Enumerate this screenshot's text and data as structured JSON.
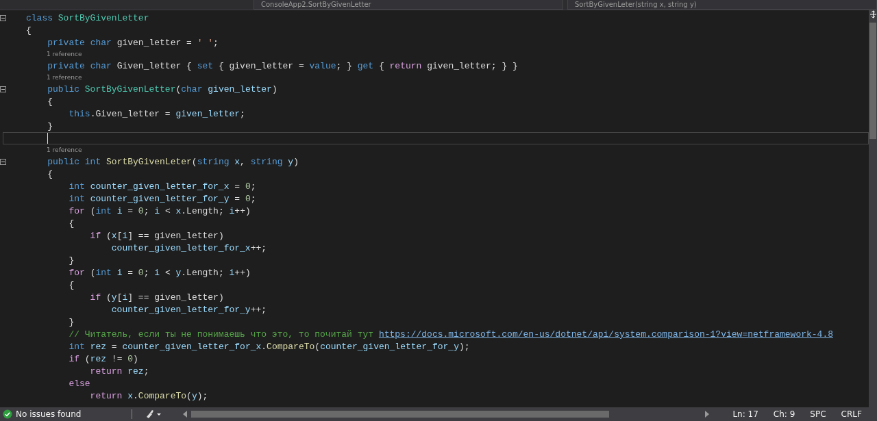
{
  "nav_bar": {
    "items": [
      "ConsoleApp2.SortByGivenLetter",
      "SortByGivenLeter(string x, string y)"
    ]
  },
  "code_lines": [
    {
      "kind": "code",
      "expanded": true,
      "current": false,
      "tokens": [
        {
          "t": "class",
          "kind": "kw"
        },
        {
          "t": " SortByGivenLetter",
          "kind": "type"
        }
      ]
    },
    {
      "kind": "code",
      "current": false,
      "tokens": [
        {
          "t": "{",
          "kind": "plain"
        }
      ]
    },
    {
      "kind": "code",
      "current": false,
      "tokens": [
        {
          "t": "    private",
          "kind": "kw"
        },
        {
          "t": " char",
          "kind": "kw"
        },
        {
          "t": " given_letter = ",
          "kind": "plain"
        },
        {
          "t": "' '",
          "kind": "str"
        },
        {
          "t": ";",
          "kind": "plain"
        }
      ]
    },
    {
      "kind": "reference",
      "text": "1 reference"
    },
    {
      "kind": "code",
      "current": false,
      "tokens": [
        {
          "t": "    private",
          "kind": "kw"
        },
        {
          "t": " char",
          "kind": "kw"
        },
        {
          "t": " Given_letter { ",
          "kind": "plain"
        },
        {
          "t": "set",
          "kind": "kw"
        },
        {
          "t": " { given_letter = ",
          "kind": "plain"
        },
        {
          "t": "value",
          "kind": "kw"
        },
        {
          "t": "; } ",
          "kind": "plain"
        },
        {
          "t": "get",
          "kind": "kw"
        },
        {
          "t": " { ",
          "kind": "plain"
        },
        {
          "t": "return",
          "kind": "ctrl"
        },
        {
          "t": " given_letter; } }",
          "kind": "plain"
        }
      ]
    },
    {
      "kind": "reference",
      "text": "1 reference"
    },
    {
      "kind": "code",
      "expanded": true,
      "current": false,
      "tokens": [
        {
          "t": "    public",
          "kind": "kw"
        },
        {
          "t": " SortByGivenLetter",
          "kind": "type"
        },
        {
          "t": "(",
          "kind": "plain"
        },
        {
          "t": "char",
          "kind": "kw"
        },
        {
          "t": " given_letter",
          "kind": "param"
        },
        {
          "t": ")",
          "kind": "plain"
        }
      ]
    },
    {
      "kind": "code",
      "current": false,
      "tokens": [
        {
          "t": "    {",
          "kind": "plain"
        }
      ]
    },
    {
      "kind": "code",
      "current": false,
      "tokens": [
        {
          "t": "        this",
          "kind": "kw"
        },
        {
          "t": ".Given_letter = ",
          "kind": "plain"
        },
        {
          "t": "given_letter",
          "kind": "param"
        },
        {
          "t": ";",
          "kind": "plain"
        }
      ]
    },
    {
      "kind": "code",
      "current": false,
      "tokens": [
        {
          "t": "    }",
          "kind": "plain"
        }
      ]
    },
    {
      "kind": "code",
      "current": true
    },
    {
      "kind": "reference",
      "text": "1 reference"
    },
    {
      "kind": "code",
      "expanded": true,
      "current": false,
      "tokens": [
        {
          "t": "    public",
          "kind": "kw"
        },
        {
          "t": " int",
          "kind": "kw"
        },
        {
          "t": " SortByGivenLeter",
          "kind": "method"
        },
        {
          "t": "(",
          "kind": "plain"
        },
        {
          "t": "string",
          "kind": "kw"
        },
        {
          "t": " x",
          "kind": "param"
        },
        {
          "t": ", ",
          "kind": "plain"
        },
        {
          "t": "string",
          "kind": "kw"
        },
        {
          "t": " y",
          "kind": "param"
        },
        {
          "t": ")",
          "kind": "plain"
        }
      ]
    },
    {
      "kind": "code",
      "current": false,
      "tokens": [
        {
          "t": "    {",
          "kind": "plain"
        }
      ]
    },
    {
      "kind": "code",
      "current": false,
      "tokens": [
        {
          "t": "        int",
          "kind": "kw"
        },
        {
          "t": " counter_given_letter_for_x",
          "kind": "local"
        },
        {
          "t": " = ",
          "kind": "plain"
        },
        {
          "t": "0",
          "kind": "num"
        },
        {
          "t": ";",
          "kind": "plain"
        }
      ]
    },
    {
      "kind": "code",
      "current": false,
      "tokens": [
        {
          "t": "        int",
          "kind": "kw"
        },
        {
          "t": " counter_given_letter_for_y",
          "kind": "local"
        },
        {
          "t": " = ",
          "kind": "plain"
        },
        {
          "t": "0",
          "kind": "num"
        },
        {
          "t": ";",
          "kind": "plain"
        }
      ]
    },
    {
      "kind": "code",
      "current": false,
      "tokens": [
        {
          "t": "        for",
          "kind": "ctrl"
        },
        {
          "t": " (",
          "kind": "plain"
        },
        {
          "t": "int",
          "kind": "kw"
        },
        {
          "t": " i",
          "kind": "local"
        },
        {
          "t": " = ",
          "kind": "plain"
        },
        {
          "t": "0",
          "kind": "num"
        },
        {
          "t": "; ",
          "kind": "plain"
        },
        {
          "t": "i",
          "kind": "local"
        },
        {
          "t": " < ",
          "kind": "plain"
        },
        {
          "t": "x",
          "kind": "param"
        },
        {
          "t": ".Length; ",
          "kind": "plain"
        },
        {
          "t": "i",
          "kind": "local"
        },
        {
          "t": "++)",
          "kind": "plain"
        }
      ]
    },
    {
      "kind": "code",
      "current": false,
      "tokens": [
        {
          "t": "        {",
          "kind": "plain"
        }
      ]
    },
    {
      "kind": "code",
      "current": false,
      "tokens": [
        {
          "t": "            if",
          "kind": "ctrl"
        },
        {
          "t": " (",
          "kind": "plain"
        },
        {
          "t": "x",
          "kind": "param"
        },
        {
          "t": "[",
          "kind": "plain"
        },
        {
          "t": "i",
          "kind": "local"
        },
        {
          "t": "] == given_letter)",
          "kind": "plain"
        }
      ]
    },
    {
      "kind": "code",
      "current": false,
      "tokens": [
        {
          "t": "                counter_given_letter_for_x",
          "kind": "local"
        },
        {
          "t": "++;",
          "kind": "plain"
        }
      ]
    },
    {
      "kind": "code",
      "current": false,
      "tokens": [
        {
          "t": "        }",
          "kind": "plain"
        }
      ]
    },
    {
      "kind": "code",
      "current": false,
      "tokens": [
        {
          "t": "        for",
          "kind": "ctrl"
        },
        {
          "t": " (",
          "kind": "plain"
        },
        {
          "t": "int",
          "kind": "kw"
        },
        {
          "t": " i",
          "kind": "local"
        },
        {
          "t": " = ",
          "kind": "plain"
        },
        {
          "t": "0",
          "kind": "num"
        },
        {
          "t": "; ",
          "kind": "plain"
        },
        {
          "t": "i",
          "kind": "local"
        },
        {
          "t": " < ",
          "kind": "plain"
        },
        {
          "t": "y",
          "kind": "param"
        },
        {
          "t": ".Length; ",
          "kind": "plain"
        },
        {
          "t": "i",
          "kind": "local"
        },
        {
          "t": "++)",
          "kind": "plain"
        }
      ]
    },
    {
      "kind": "code",
      "current": false,
      "tokens": [
        {
          "t": "        {",
          "kind": "plain"
        }
      ]
    },
    {
      "kind": "code",
      "current": false,
      "tokens": [
        {
          "t": "            if",
          "kind": "ctrl"
        },
        {
          "t": " (",
          "kind": "plain"
        },
        {
          "t": "y",
          "kind": "param"
        },
        {
          "t": "[",
          "kind": "plain"
        },
        {
          "t": "i",
          "kind": "local"
        },
        {
          "t": "] == given_letter)",
          "kind": "plain"
        }
      ]
    },
    {
      "kind": "code",
      "current": false,
      "tokens": [
        {
          "t": "                counter_given_letter_for_y",
          "kind": "local"
        },
        {
          "t": "++;",
          "kind": "plain"
        }
      ]
    },
    {
      "kind": "code",
      "current": false,
      "tokens": [
        {
          "t": "        }",
          "kind": "plain"
        }
      ]
    },
    {
      "kind": "code",
      "current": false,
      "tokens": [
        {
          "t": "        // Читатель, если ты не понимаешь что это, то почитай тут ",
          "kind": "comment"
        },
        {
          "t": "https://docs.microsoft.com/en-us/dotnet/api/system.comparison-1?view=netframework-4.8",
          "kind": "link"
        }
      ]
    },
    {
      "kind": "code",
      "current": false,
      "tokens": [
        {
          "t": "        int",
          "kind": "kw"
        },
        {
          "t": " rez",
          "kind": "local"
        },
        {
          "t": " = ",
          "kind": "plain"
        },
        {
          "t": "counter_given_letter_for_x",
          "kind": "local"
        },
        {
          "t": ".",
          "kind": "plain"
        },
        {
          "t": "CompareTo",
          "kind": "method"
        },
        {
          "t": "(",
          "kind": "plain"
        },
        {
          "t": "counter_given_letter_for_y",
          "kind": "local"
        },
        {
          "t": ");",
          "kind": "plain"
        }
      ]
    },
    {
      "kind": "code",
      "current": false,
      "tokens": [
        {
          "t": "        if",
          "kind": "ctrl"
        },
        {
          "t": " (",
          "kind": "plain"
        },
        {
          "t": "rez",
          "kind": "local"
        },
        {
          "t": " != ",
          "kind": "plain"
        },
        {
          "t": "0",
          "kind": "num"
        },
        {
          "t": ")",
          "kind": "plain"
        }
      ]
    },
    {
      "kind": "code",
      "current": false,
      "tokens": [
        {
          "t": "            return",
          "kind": "ctrl"
        },
        {
          "t": " rez",
          "kind": "local"
        },
        {
          "t": ";",
          "kind": "plain"
        }
      ]
    },
    {
      "kind": "code",
      "current": false,
      "tokens": [
        {
          "t": "        else",
          "kind": "ctrl"
        }
      ]
    },
    {
      "kind": "code",
      "current": false,
      "tokens": [
        {
          "t": "            return",
          "kind": "ctrl"
        },
        {
          "t": " x",
          "kind": "param"
        },
        {
          "t": ".",
          "kind": "plain"
        },
        {
          "t": "CompareTo",
          "kind": "method"
        },
        {
          "t": "(",
          "kind": "plain"
        },
        {
          "t": "y",
          "kind": "param"
        },
        {
          "t": ");",
          "kind": "plain"
        }
      ]
    }
  ],
  "status_bar": {
    "issues": "No issues found",
    "line": "Ln: 17",
    "column": "Ch: 9",
    "whitespace": "SPC",
    "line_ending": "CRLF"
  }
}
